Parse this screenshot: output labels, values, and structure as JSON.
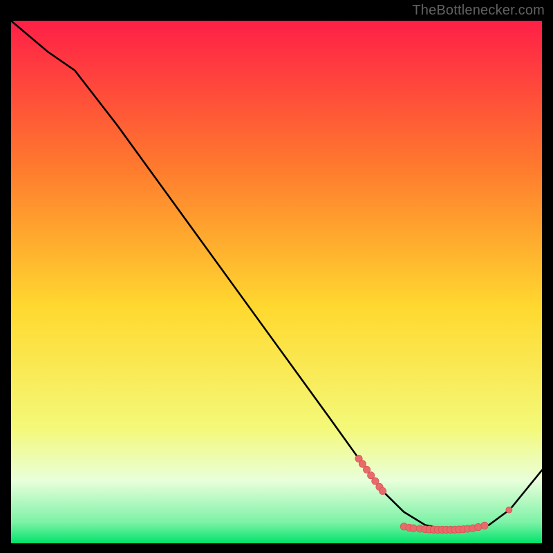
{
  "attribution": "TheBottlenecker.com",
  "colors": {
    "frame_bg": "#000000",
    "gradient_top": "#ff1f47",
    "gradient_mid_upper": "#ff7a2e",
    "gradient_mid": "#ffd92f",
    "gradient_mid_lower": "#f4f979",
    "gradient_band_pale": "#e9ffdb",
    "gradient_green": "#00e36a",
    "curve_stroke": "#000000",
    "marker_fill": "#e86a6a",
    "marker_stroke": "#cf4e4e"
  },
  "chart_data": {
    "type": "line",
    "title": "",
    "xlabel": "",
    "ylabel": "",
    "xlim": [
      0,
      100
    ],
    "ylim": [
      0,
      100
    ],
    "curve": [
      {
        "x": 0,
        "y": 100
      },
      {
        "x": 7,
        "y": 94
      },
      {
        "x": 12,
        "y": 90.5
      },
      {
        "x": 20,
        "y": 80
      },
      {
        "x": 30,
        "y": 66
      },
      {
        "x": 40,
        "y": 52
      },
      {
        "x": 50,
        "y": 38
      },
      {
        "x": 60,
        "y": 24
      },
      {
        "x": 66,
        "y": 15.5
      },
      {
        "x": 70,
        "y": 10
      },
      {
        "x": 74,
        "y": 6
      },
      {
        "x": 78,
        "y": 3.5
      },
      {
        "x": 82,
        "y": 2.6
      },
      {
        "x": 86,
        "y": 2.6
      },
      {
        "x": 90,
        "y": 3.5
      },
      {
        "x": 94,
        "y": 6.5
      },
      {
        "x": 100,
        "y": 14
      }
    ],
    "markers_cluster_a": [
      {
        "x": 65.5,
        "y": 16.2
      },
      {
        "x": 66.2,
        "y": 15.2
      },
      {
        "x": 67.0,
        "y": 14.1
      },
      {
        "x": 67.8,
        "y": 13.0
      },
      {
        "x": 68.6,
        "y": 11.9
      },
      {
        "x": 69.4,
        "y": 10.8
      },
      {
        "x": 70.0,
        "y": 10.0
      }
    ],
    "markers_cluster_b": [
      {
        "x": 74.0,
        "y": 3.2
      },
      {
        "x": 75.0,
        "y": 3.0
      },
      {
        "x": 75.8,
        "y": 2.9
      },
      {
        "x": 77.0,
        "y": 2.8
      },
      {
        "x": 78.0,
        "y": 2.7
      },
      {
        "x": 78.8,
        "y": 2.65
      },
      {
        "x": 79.6,
        "y": 2.62
      },
      {
        "x": 80.4,
        "y": 2.6
      },
      {
        "x": 81.2,
        "y": 2.6
      },
      {
        "x": 82.0,
        "y": 2.6
      },
      {
        "x": 82.8,
        "y": 2.6
      },
      {
        "x": 83.6,
        "y": 2.62
      },
      {
        "x": 84.4,
        "y": 2.65
      },
      {
        "x": 85.2,
        "y": 2.7
      },
      {
        "x": 86.0,
        "y": 2.78
      },
      {
        "x": 87.0,
        "y": 2.9
      },
      {
        "x": 88.0,
        "y": 3.1
      },
      {
        "x": 89.2,
        "y": 3.4
      }
    ],
    "markers_outlier": [
      {
        "x": 93.8,
        "y": 6.4
      }
    ]
  }
}
